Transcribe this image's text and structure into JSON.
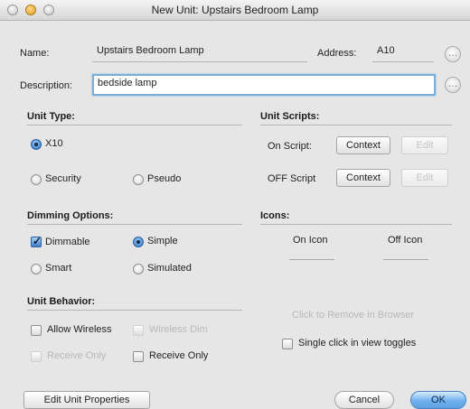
{
  "window": {
    "title": "New Unit: Upstairs Bedroom Lamp"
  },
  "identity": {
    "name_label": "Name:",
    "name_value": "Upstairs Bedroom Lamp",
    "address_label": "Address:",
    "address_value": "A10",
    "description_label": "Description:",
    "description_value": "bedside lamp"
  },
  "unit_type": {
    "heading": "Unit Type:",
    "x10_label": "X10",
    "security_label": "Security",
    "pseudo_label": "Pseudo",
    "selected": "X10"
  },
  "unit_scripts": {
    "heading": "Unit Scripts:",
    "on_label": "On Script:",
    "off_label": "OFF Script",
    "context_label": "Context",
    "edit_label": "Edit"
  },
  "dimming": {
    "heading": "Dimming Options:",
    "dimmable_label": "Dimmable",
    "dimmable_checked": true,
    "simple_label": "Simple",
    "smart_label": "Smart",
    "simulated_label": "Simulated",
    "selected": "Simple"
  },
  "icons": {
    "heading": "Icons:",
    "on_icon_label": "On Icon",
    "off_icon_label": "Off Icon"
  },
  "behavior": {
    "heading": "Unit Behavior:",
    "allow_wireless_label": "Allow Wireless",
    "wireless_dim_label": "Wireless Dim",
    "receive_only_label": "Receive Only",
    "disabled_right_label": "Click to Remove in Browser",
    "single_click_label": "Single click in view toggles"
  },
  "footer": {
    "edit_properties_label": "Edit Unit Properties",
    "cancel_label": "Cancel",
    "ok_label": "OK"
  },
  "colors": {
    "accent": "#5ea2e4",
    "focus_ring": "#7aaed9"
  }
}
